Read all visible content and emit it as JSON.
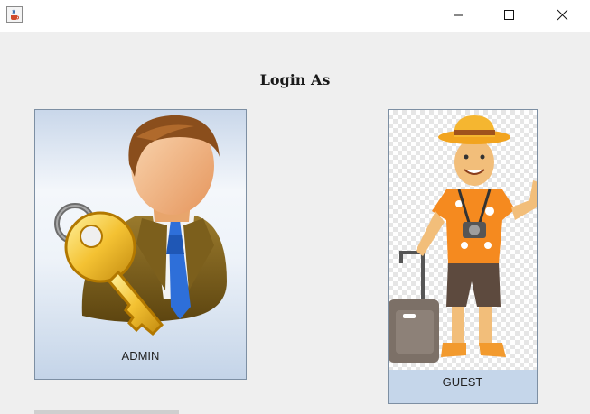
{
  "window": {
    "icon": "java-cup-icon",
    "controls": [
      "minimize-icon",
      "maximize-icon",
      "close-icon"
    ]
  },
  "heading": "Login As",
  "admin": {
    "label": "ADMIN",
    "image": "admin-key-user-icon"
  },
  "guest": {
    "label": "GUEST",
    "image": "tourist-guest-icon"
  },
  "colors": {
    "card_border": "#7d8fa3",
    "card_bg": "#c5d6ea",
    "window_bg": "#efefef"
  }
}
